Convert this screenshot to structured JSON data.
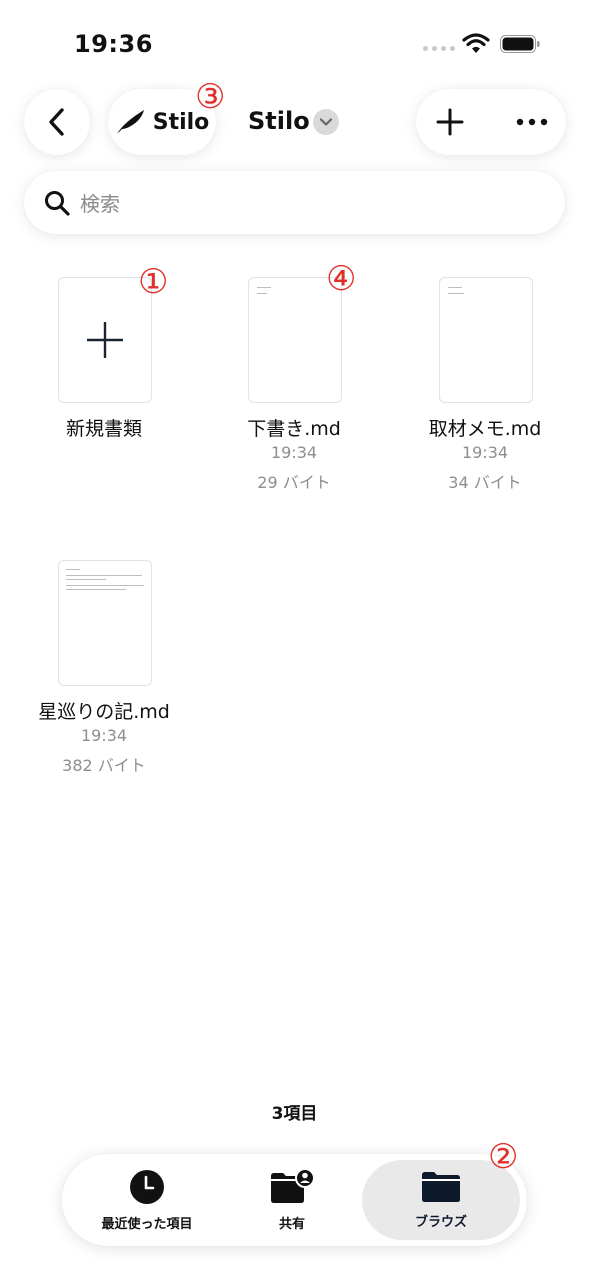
{
  "status_bar": {
    "time": "19:36"
  },
  "header": {
    "back_icon": "chevron-left-icon",
    "app_button_label": "Stilo",
    "app_icon": "quill-icon",
    "title": "Stilo",
    "title_menu_icon": "chevron-down-icon",
    "add_icon": "plus-icon",
    "more_icon": "ellipsis-icon"
  },
  "search": {
    "placeholder": "検索",
    "icon": "search-icon"
  },
  "annotations": {
    "m1": "①",
    "m2": "②",
    "m3": "③",
    "m4": "④"
  },
  "files": [
    {
      "name": "新規書類",
      "time": "",
      "size": "",
      "kind": "new-document"
    },
    {
      "name": "下書き.md",
      "time": "19:34",
      "size": "29 バイト",
      "kind": "markdown"
    },
    {
      "name": "取材メモ.md",
      "time": "19:34",
      "size": "34 バイト",
      "kind": "markdown"
    },
    {
      "name": "星巡りの記.md",
      "time": "19:34",
      "size": "382 バイト",
      "kind": "markdown"
    }
  ],
  "footer": {
    "item_count": "3項目"
  },
  "tabs": [
    {
      "label": "最近使った項目",
      "icon": "clock-icon",
      "selected": false
    },
    {
      "label": "共有",
      "icon": "shared-folder-icon",
      "selected": false
    },
    {
      "label": "ブラウズ",
      "icon": "folder-icon",
      "selected": true
    }
  ]
}
